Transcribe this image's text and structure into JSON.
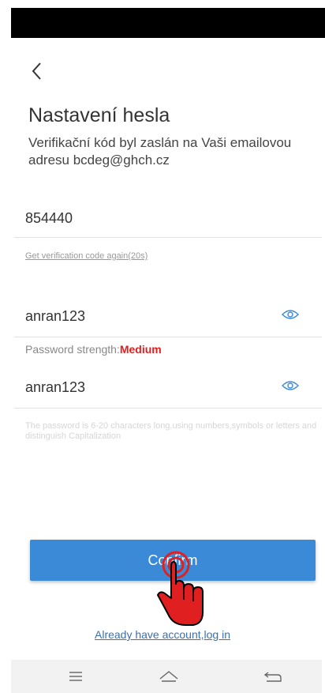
{
  "header": {
    "back_icon": "chevron-left-icon",
    "title": "Nastavení hesla",
    "subtitle": "Verifikační kód byl zaslán na Vaši emailovou adresu bcdeg@ghch.cz"
  },
  "form": {
    "code_value": "854440",
    "resend_label": "Get verification code again(20s)",
    "password_value": "anran123",
    "strength_label": "Password strength:",
    "strength_level": "Medium",
    "confirm_password_value": "anran123",
    "hint": "The password is 6-20 characters long,using numbers,symbols or letters and distinguish Capitalization",
    "eye_icon": "eye-icon"
  },
  "actions": {
    "confirm_label": "Confirm",
    "login_link": "Already have account,log in"
  },
  "navbar": {
    "icons": [
      "menu-icon",
      "home-icon",
      "back-icon"
    ]
  },
  "colors": {
    "accent": "#3a8ad8",
    "strength_medium": "#e02020",
    "link": "#3a70b0",
    "tap_indicator": "#e02020"
  }
}
